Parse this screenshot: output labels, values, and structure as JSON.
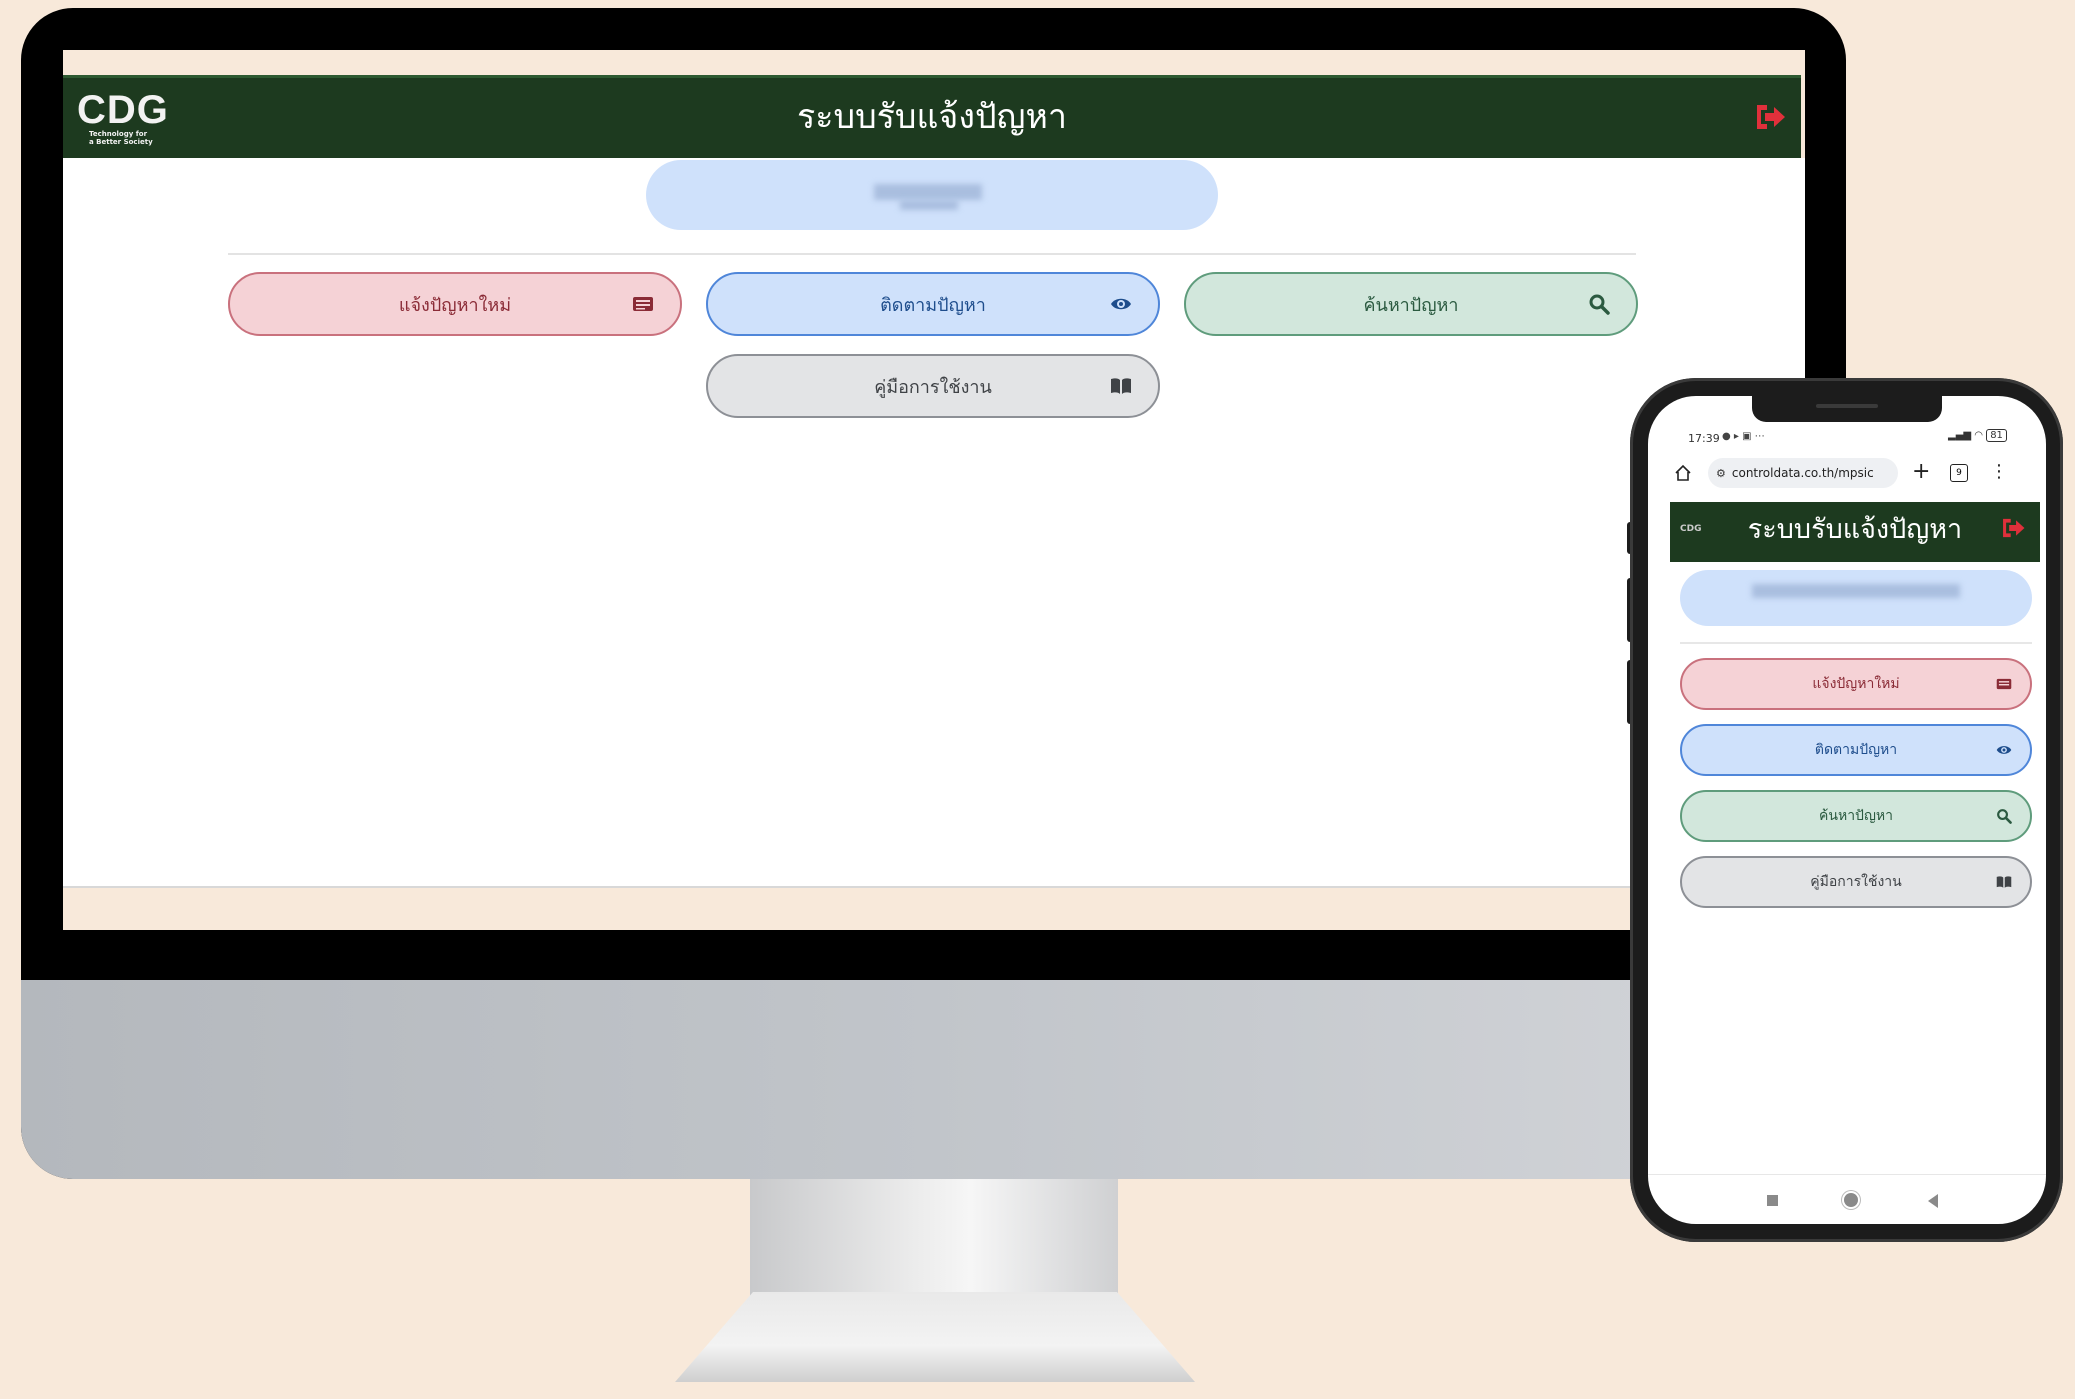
{
  "app": {
    "title": "ระบบรับแจ้งปัญหา",
    "logo_text": "CDG",
    "logo_tagline_1": "Technology for",
    "logo_tagline_2": "a Better Society"
  },
  "menu": {
    "new_issue": "แจ้งปัญหาใหม่",
    "track_issue": "ติดตามปัญหา",
    "search_issue": "ค้นหาปัญหา",
    "user_manual": "คู่มือการใช้งาน"
  },
  "phone": {
    "status_time": "17:39",
    "battery": "81",
    "url": "controldata.co.th/mpsic",
    "tab_count": "9"
  },
  "colors": {
    "header_bg": "#1d3a1f",
    "logout_red": "#e0303b",
    "btn_new": "#f5d2d6",
    "btn_track": "#cfe1fb",
    "btn_search": "#d2e7dc",
    "btn_manual": "#e3e4e6"
  },
  "icons": {
    "new_issue": "list-icon",
    "track_issue": "eye-icon",
    "search_issue": "magnifier-icon",
    "user_manual": "book-icon",
    "logout": "sign-out-icon"
  }
}
